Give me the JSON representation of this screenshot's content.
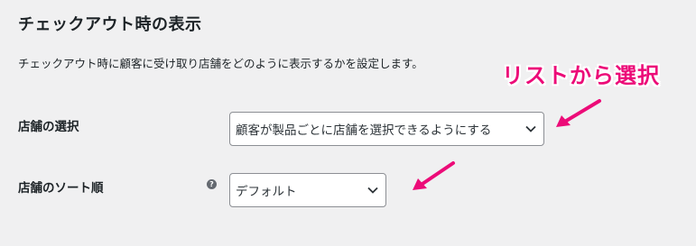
{
  "section": {
    "title": "チェックアウト時の表示",
    "description": "チェックアウト時に顧客に受け取り店舗をどのように表示するかを設定します。"
  },
  "fields": {
    "store_selection": {
      "label": "店舗の選択",
      "value": "顧客が製品ごとに店舗を選択できるようにする"
    },
    "store_sort": {
      "label": "店舗のソート順",
      "help": "?",
      "value": "デフォルト"
    }
  },
  "annotation": {
    "text": "リストから選択",
    "color": "#ec0b78"
  },
  "icons": {
    "dropdown": "chevron-down-icon",
    "help": "help-icon",
    "arrow": "arrow-icon"
  }
}
